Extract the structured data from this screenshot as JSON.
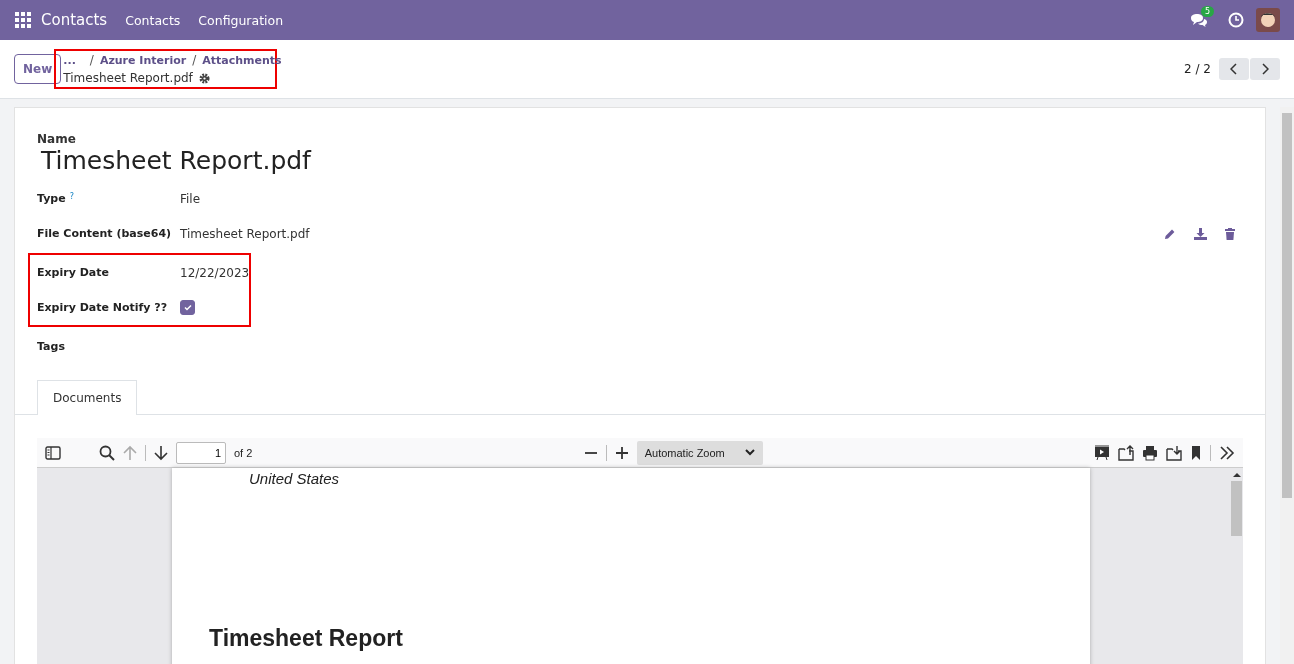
{
  "navbar": {
    "app_name": "Contacts",
    "menu": [
      "Contacts",
      "Configuration"
    ],
    "messages_badge": "5"
  },
  "control_panel": {
    "new_button": "New",
    "breadcrumbs": [
      "...",
      "Azure Interior",
      "Attachments"
    ],
    "current": "Timesheet Report.pdf",
    "separator": "/",
    "highlighted": true,
    "pager": "2 / 2"
  },
  "form": {
    "name_label": "Name",
    "name": "Timesheet Report.pdf",
    "fields": [
      {
        "kind": "text",
        "label": "Type",
        "help": "?",
        "value": "File",
        "highlighted": false
      },
      {
        "kind": "file",
        "label": "File Content (base64)",
        "value": "Timesheet Report.pdf",
        "highlighted": false
      },
      {
        "kind": "text",
        "label": "Expiry Date",
        "value": "12/22/2023",
        "highlighted": true
      },
      {
        "kind": "checkbox",
        "label": "Expiry Date Notify ??",
        "checked": true,
        "highlighted": true
      },
      {
        "kind": "text",
        "label": "Tags",
        "highlighted": false
      }
    ]
  },
  "tabs": [
    {
      "label": "Documents",
      "selected": true
    }
  ],
  "pdf_viewer": {
    "page": "1",
    "page_count": "of 2",
    "zoom": "Automatic Zoom",
    "content": [
      "United States",
      "Timesheet Report"
    ]
  }
}
